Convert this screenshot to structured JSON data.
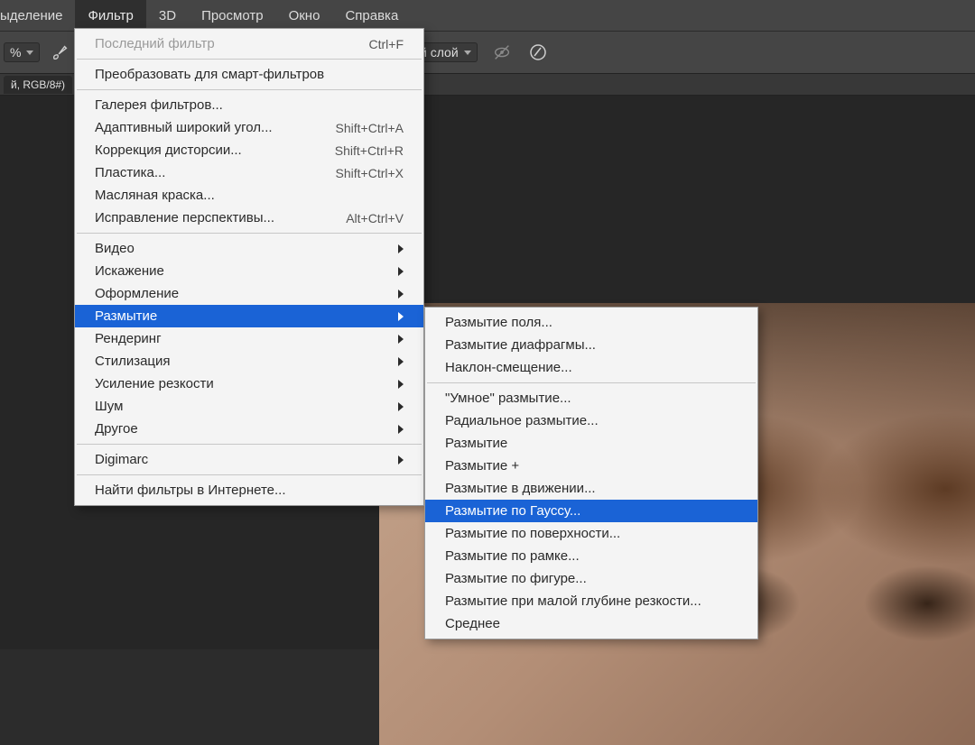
{
  "menubar": {
    "items": [
      "ыделение",
      "Фильтр",
      "3D",
      "Просмотр",
      "Окно",
      "Справка"
    ],
    "active_index": 1
  },
  "optionsbar": {
    "percent_suffix": "%",
    "layer_tail": "й слой"
  },
  "tab": {
    "label": "й, RGB/8#)"
  },
  "filter_menu": {
    "last_filter": {
      "label": "Последний фильтр",
      "shortcut": "Ctrl+F"
    },
    "convert_smart": {
      "label": "Преобразовать для смарт-фильтров"
    },
    "filter_gallery": {
      "label": "Галерея фильтров..."
    },
    "adaptive_wide": {
      "label": "Адаптивный широкий угол...",
      "shortcut": "Shift+Ctrl+A"
    },
    "lens_correction": {
      "label": "Коррекция дисторсии...",
      "shortcut": "Shift+Ctrl+R"
    },
    "liquify": {
      "label": "Пластика...",
      "shortcut": "Shift+Ctrl+X"
    },
    "oil_paint": {
      "label": "Масляная краска..."
    },
    "vanishing_point": {
      "label": "Исправление перспективы...",
      "shortcut": "Alt+Ctrl+V"
    },
    "video": {
      "label": "Видео"
    },
    "distort": {
      "label": "Искажение"
    },
    "pixelate": {
      "label": "Оформление"
    },
    "blur": {
      "label": "Размытие"
    },
    "render": {
      "label": "Рендеринг"
    },
    "stylize": {
      "label": "Стилизация"
    },
    "sharpen": {
      "label": "Усиление резкости"
    },
    "noise": {
      "label": "Шум"
    },
    "other": {
      "label": "Другое"
    },
    "digimarc": {
      "label": "Digimarc"
    },
    "browse_online": {
      "label": "Найти фильтры в Интернете..."
    }
  },
  "blur_submenu": {
    "field_blur": "Размытие поля...",
    "iris_blur": "Размытие диафрагмы...",
    "tilt_shift": "Наклон-смещение...",
    "smart_blur": "\"Умное\" размытие...",
    "radial_blur": "Радиальное размытие...",
    "blur": "Размытие",
    "blur_more": "Размытие +",
    "motion_blur": "Размытие в движении...",
    "gaussian_blur": "Размытие по Гауссу...",
    "surface_blur": "Размытие по поверхности...",
    "box_blur": "Размытие по рамке...",
    "shape_blur": "Размытие по фигуре...",
    "lens_blur": "Размытие при малой глубине резкости...",
    "average": "Среднее"
  }
}
